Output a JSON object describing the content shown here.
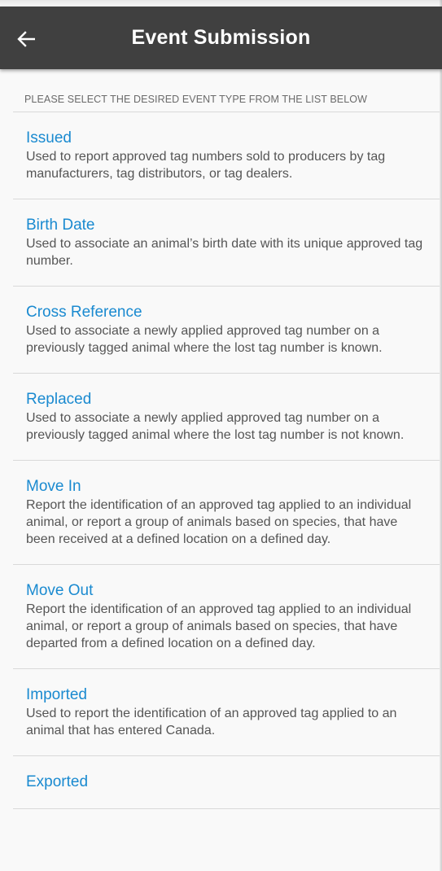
{
  "header": {
    "title": "Event Submission",
    "back_icon": "arrow-left-icon",
    "background_color": "#404040"
  },
  "instruction": "PLEASE SELECT THE DESIRED EVENT TYPE FROM THE LIST BELOW",
  "accent_color": "#1a8ad0",
  "events": [
    {
      "title": "Issued",
      "description": "Used to report approved tag numbers sold to producers by tag manufacturers, tag distributors, or tag dealers."
    },
    {
      "title": "Birth Date",
      "description": "Used to associate an animal’s birth date with its unique approved tag number."
    },
    {
      "title": "Cross Reference",
      "description": "Used to associate a newly applied approved tag number on a previously tagged animal where the lost tag number is known."
    },
    {
      "title": "Replaced",
      "description": "Used to associate a newly applied approved tag number on a previously tagged animal where the lost tag number is not known."
    },
    {
      "title": "Move In",
      "description": "Report the identification of an approved tag applied to an individual animal, or report a group of animals based on species, that have been received at a defined location on a defined day."
    },
    {
      "title": "Move Out",
      "description": "Report the identification of an approved tag applied to an individual animal, or report a group of animals based on species, that have departed from a defined location on a defined day."
    },
    {
      "title": "Imported",
      "description": "Used to report the identification of an approved tag applied to an animal that has entered Canada."
    },
    {
      "title": "Exported",
      "description": ""
    }
  ]
}
